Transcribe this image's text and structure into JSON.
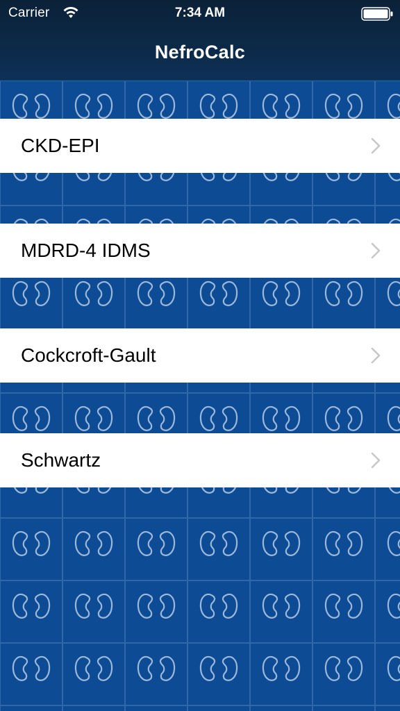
{
  "status_bar": {
    "carrier": "Carrier",
    "time": "7:34 AM",
    "wifi_icon": "wifi-icon",
    "battery_icon": "battery-full-icon"
  },
  "nav": {
    "title": "NefroCalc"
  },
  "menu": {
    "items": [
      {
        "label": "CKD-EPI",
        "icon": "chevron-right-icon"
      },
      {
        "label": "MDRD-4 IDMS",
        "icon": "chevron-right-icon"
      },
      {
        "label": "Cockcroft-Gault",
        "icon": "chevron-right-icon"
      },
      {
        "label": "Schwartz",
        "icon": "chevron-right-icon"
      }
    ]
  },
  "background": {
    "pattern_icon": "kidney-icon"
  },
  "colors": {
    "nav_background": "#0c2a48",
    "pattern_background": "#0d4c94",
    "pattern_line": "#9bb8da",
    "cell_background": "#ffffff",
    "chevron": "#c7c7cc"
  }
}
